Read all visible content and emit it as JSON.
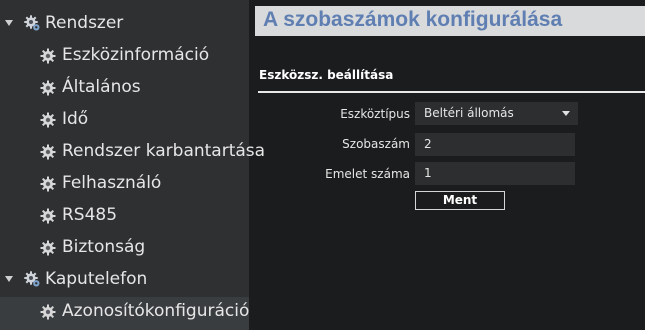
{
  "sidebar": {
    "groups": [
      {
        "label": "Rendszer",
        "items": [
          {
            "label": "Eszközinformáció"
          },
          {
            "label": "Általános"
          },
          {
            "label": "Idő"
          },
          {
            "label": "Rendszer karbantartása"
          },
          {
            "label": "Felhasználó"
          },
          {
            "label": "RS485"
          },
          {
            "label": "Biztonság"
          }
        ]
      },
      {
        "label": "Kaputelefon",
        "items": [
          {
            "label": "Azonosítókonfiguráció",
            "selected": true
          }
        ]
      }
    ]
  },
  "main": {
    "title": "A szobaszámok konfigurálása",
    "section_title": "Eszközsz. beállítása",
    "fields": {
      "device_type": {
        "label": "Eszköztípus",
        "value": "Beltéri állomás"
      },
      "room_number": {
        "label": "Szobaszám",
        "value": "2"
      },
      "floor_number": {
        "label": "Emelet száma",
        "value": "1"
      }
    },
    "ok_label": "Ment"
  },
  "colors": {
    "title_text": "#5f7fb3",
    "title_bar": "#d9dadb",
    "sidebar_bg": "#2e3032",
    "page_bg": "#1b1c1d"
  },
  "icons": {
    "tree_expand": "caret-down-icon",
    "group": "gear-group-icon",
    "item": "gear-icon"
  }
}
